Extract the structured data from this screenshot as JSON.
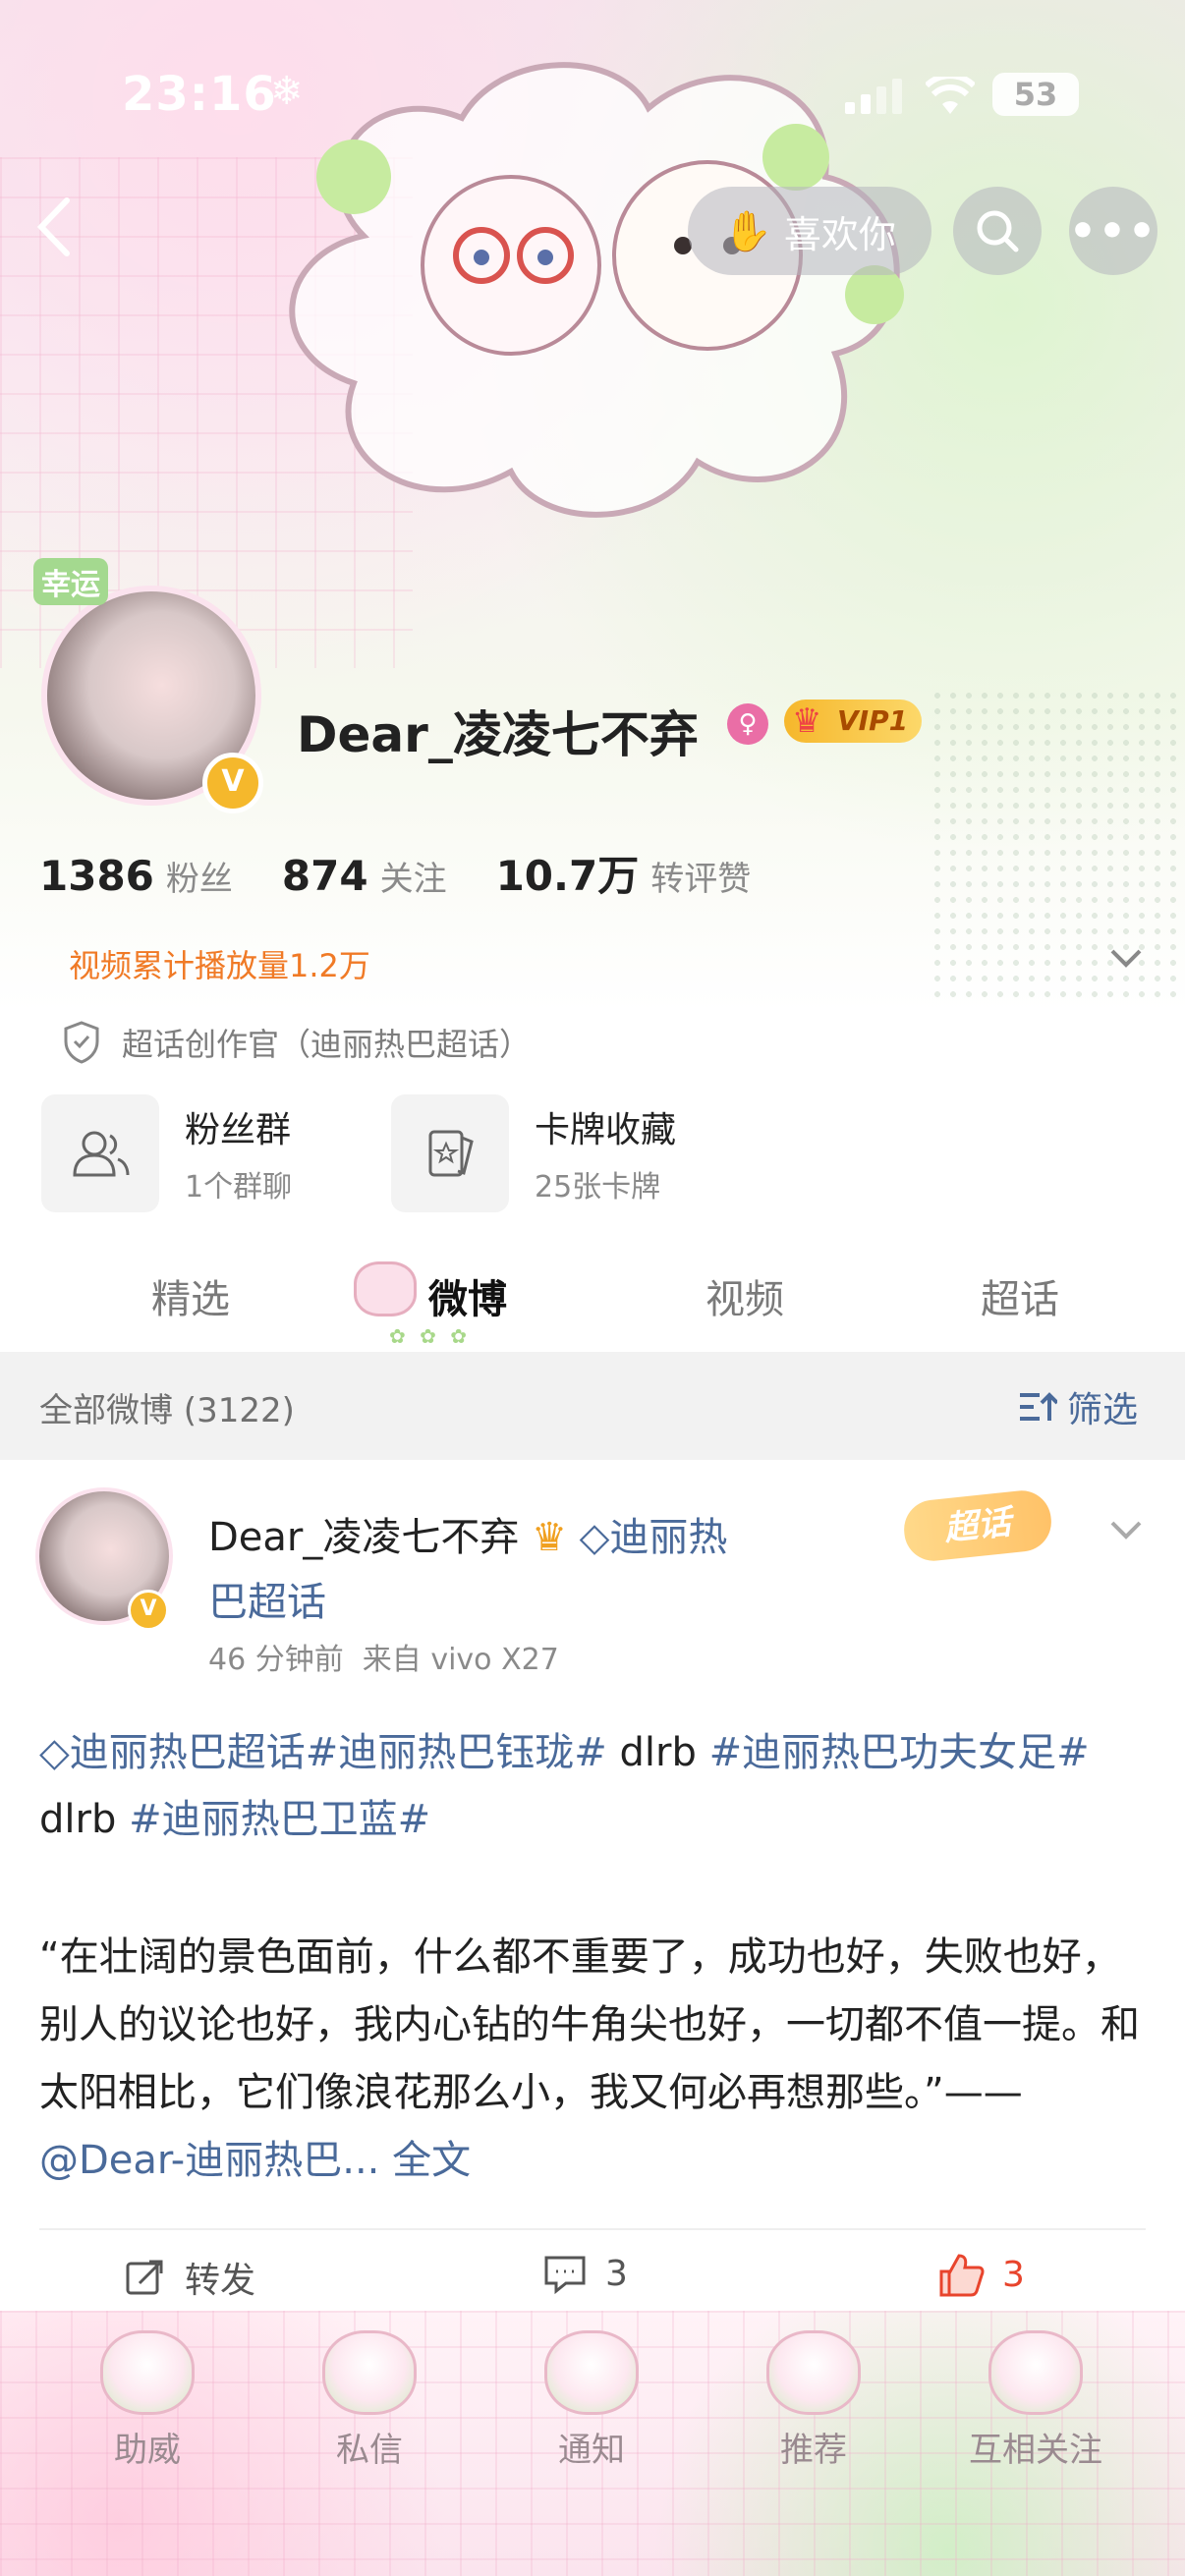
{
  "status_bar": {
    "time": "23:16",
    "battery": "53"
  },
  "header": {
    "like_label": "喜欢你",
    "more_label": "•••"
  },
  "profile": {
    "avatar_badge": "幸运",
    "username": "Dear_凌凌七不弃",
    "verified_glyph": "V",
    "vip_label": "VIP1",
    "stats": [
      {
        "num": "1386",
        "label": "粉丝"
      },
      {
        "num": "874",
        "label": "关注"
      },
      {
        "num": "10.7万",
        "label": "转评赞"
      }
    ],
    "video_count": "视频累计播放量1.2万",
    "creator_title": "超话创作官（迪丽热巴超话）",
    "features": [
      {
        "title": "粉丝群",
        "sub": "1个群聊"
      },
      {
        "title": "卡牌收藏",
        "sub": "25张卡牌"
      }
    ]
  },
  "tabs": [
    {
      "label": "精选",
      "active": false
    },
    {
      "label": "微博",
      "active": true
    },
    {
      "label": "视频",
      "active": false
    },
    {
      "label": "超话",
      "active": false
    }
  ],
  "filter": {
    "left_label": "全部微博 (3122)",
    "right_label": "筛选"
  },
  "post": {
    "author": "Dear_凌凌七不弃",
    "topic_line1": "迪丽热",
    "topic_line2": "巴超话",
    "time": "46 分钟前",
    "source": "来自 vivo X27",
    "badge": "超话",
    "tags": {
      "t1": "迪丽热巴超话",
      "t2": "#迪丽热巴钰珑#",
      "t3": " dlrb ",
      "t4": "#迪丽热巴功夫女足#",
      "t5": " dlrb ",
      "t6": "#迪丽热巴卫蓝#"
    },
    "quote_text": "“在壮阔的景色面前，什么都不重要了，成功也好，失败也好，别人的议论也好，我内心钻的牛角尖也好，一切都不值一提。和太阳相比，它们像浪花那么小，我又何必再想那些。”——",
    "quote_mention": "@Dear-迪丽热巴...",
    "quote_more": " 全文",
    "actions": {
      "repost": "转发",
      "comments": "3",
      "likes": "3"
    }
  },
  "bottom_nav": [
    {
      "label": "助威"
    },
    {
      "label": "私信"
    },
    {
      "label": "通知"
    },
    {
      "label": "推荐"
    },
    {
      "label": "互相关注"
    }
  ],
  "colors": {
    "accent_link": "#4a6a9a",
    "orange": "#f07a26",
    "like_red": "#e8442c"
  }
}
